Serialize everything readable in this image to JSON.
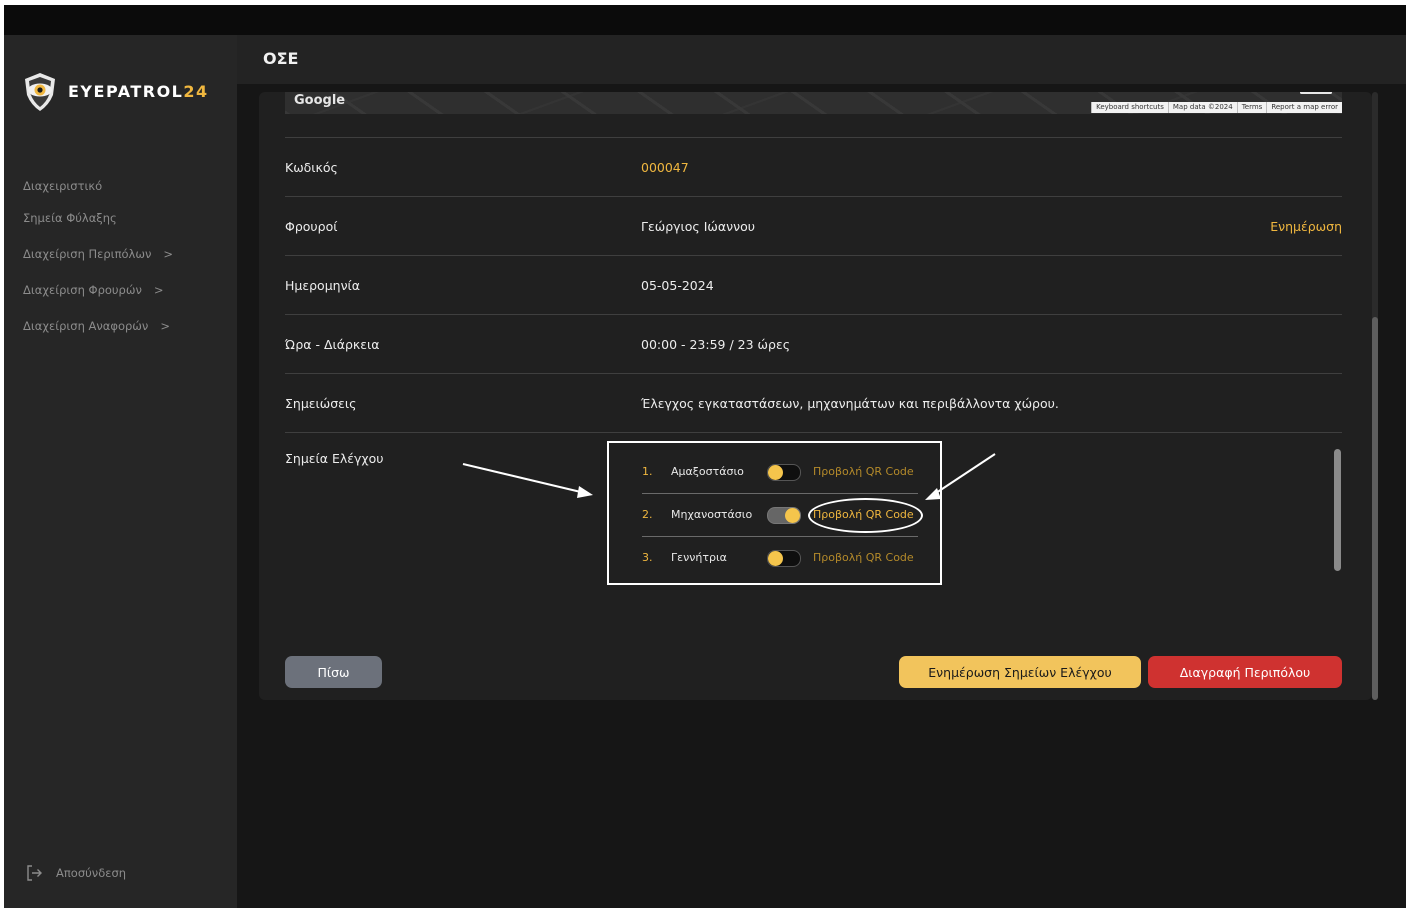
{
  "app": {
    "brand_prefix": "EYEPATROL",
    "brand_suffix": "24",
    "page_title": "ΟΣΕ",
    "accent_color": "#f0b73f"
  },
  "sidebar": {
    "items": [
      {
        "label": "Διαχειριστικό",
        "chevron": ""
      },
      {
        "label": "Σημεία Φύλαξης",
        "chevron": ""
      },
      {
        "label": "Διαχείριση Περιπόλων",
        "chevron": ">"
      },
      {
        "label": "Διαχείριση Φρουρών",
        "chevron": ">"
      },
      {
        "label": "Διαχείριση Αναφορών",
        "chevron": ">"
      }
    ],
    "logout_label": "Αποσύνδεση"
  },
  "map": {
    "google_label": "Google",
    "links": [
      "Keyboard shortcuts",
      "Map data ©2024",
      "Terms",
      "Report a map error"
    ]
  },
  "details": {
    "code": {
      "label": "Κωδικός",
      "value": "000047"
    },
    "guards": {
      "label": "Φρουροί",
      "value": "Γεώργιος Ιώαννου",
      "action": "Ενημέρωση"
    },
    "date": {
      "label": "Ημερομηνία",
      "value": "05-05-2024"
    },
    "time": {
      "label": "Ώρα - Διάρκεια",
      "value": "00:00 - 23:59 / 23 ώρες"
    },
    "notes": {
      "label": "Σημειώσεις",
      "value": "Έλεγχος εγκαταστάσεων, μηχανημάτων και περιβάλλοντα χώρου."
    }
  },
  "checkpoints": {
    "label": "Σημεία Ελέγχου",
    "items": [
      {
        "number": "1.",
        "name": "Αμαξοστάσιο",
        "toggle": "off",
        "qr_label": "Προβολή QR Code"
      },
      {
        "number": "2.",
        "name": "Μηχανοστάσιο",
        "toggle": "on",
        "qr_label": "Προβολή QR Code"
      },
      {
        "number": "3.",
        "name": "Γεννήτρια",
        "toggle": "off",
        "qr_label": "Προβολή QR Code"
      }
    ]
  },
  "buttons": {
    "back": "Πίσω",
    "update_checkpoints": "Ενημέρωση Σημείων Ελέγχου",
    "delete_patrol": "Διαγραφή Περιπόλου"
  }
}
